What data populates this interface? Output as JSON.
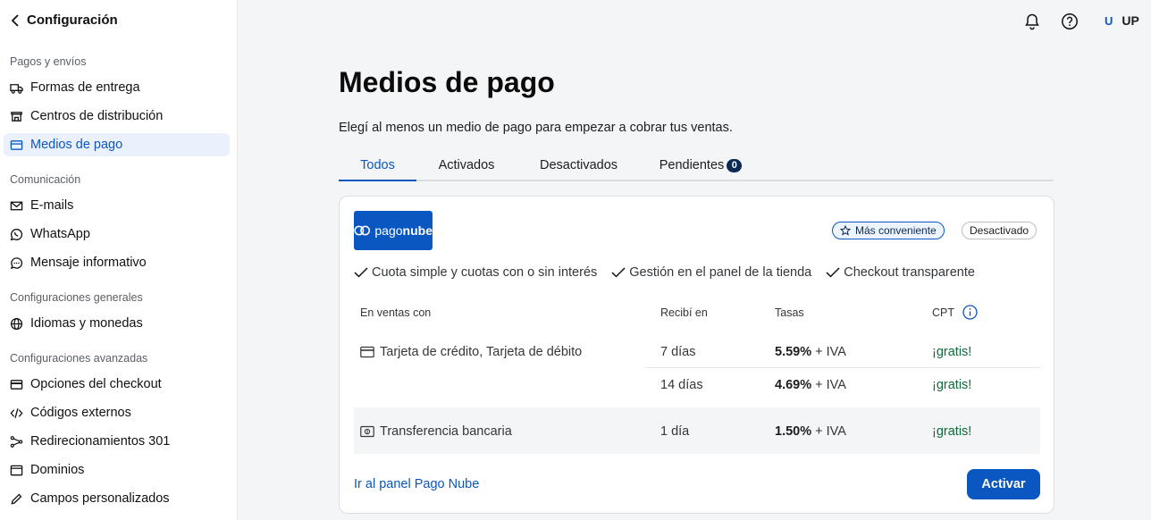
{
  "sidebar": {
    "back_label": "Configuración",
    "sections": [
      {
        "title": "Pagos y envíos"
      },
      {
        "title": "Comunicación"
      },
      {
        "title": "Configuraciones generales"
      },
      {
        "title": "Configuraciones avanzadas"
      }
    ],
    "items": [
      {
        "label": "Formas de entrega",
        "icon": "truck-icon"
      },
      {
        "label": "Centros de distribución",
        "icon": "store-icon"
      },
      {
        "label": "Medios de pago",
        "icon": "payment-icon",
        "active": true
      },
      {
        "label": "E-mails",
        "icon": "mail-icon"
      },
      {
        "label": "WhatsApp",
        "icon": "whatsapp-icon"
      },
      {
        "label": "Mensaje informativo",
        "icon": "chat-icon"
      },
      {
        "label": "Idiomas y monedas",
        "icon": "globe-icon"
      },
      {
        "label": "Opciones del checkout",
        "icon": "card-icon"
      },
      {
        "label": "Códigos externos",
        "icon": "code-icon"
      },
      {
        "label": "Redirecionamientos 301",
        "icon": "redirect-icon"
      },
      {
        "label": "Dominios",
        "icon": "browser-icon"
      },
      {
        "label": "Campos personalizados",
        "icon": "pencil-icon"
      }
    ]
  },
  "header": {
    "user_initial": "U",
    "user_label": "UP"
  },
  "main": {
    "title": "Medios de pago",
    "subtitle": "Elegí al menos un medio de pago para empezar a cobrar tus ventas.",
    "tabs": [
      {
        "label": "Todos",
        "active": true
      },
      {
        "label": "Activados"
      },
      {
        "label": "Desactivados"
      },
      {
        "label": "Pendientes",
        "count": "0"
      }
    ]
  },
  "card": {
    "logo_text_a": "pago",
    "logo_text_b": "nube",
    "chip_convenient": "Más conveniente",
    "chip_status": "Desactivado",
    "features": [
      "Cuota simple y cuotas con o sin interés",
      "Gestión en el panel de la tienda",
      "Checkout transparente"
    ],
    "table": {
      "headers": [
        "En ventas con",
        "Recibí en",
        "Tasas",
        "CPT"
      ],
      "rows": [
        {
          "method": "Tarjeta de crédito, Tarjeta de débito",
          "receive": "7 días",
          "rate": "5.59%",
          "tax": " + IVA",
          "cpt": "¡gratis!"
        },
        {
          "method": "",
          "receive": "14 días",
          "rate": "4.69%",
          "tax": " + IVA",
          "cpt": "¡gratis!"
        },
        {
          "method": "Transferencia bancaria",
          "receive": "1 día",
          "rate": "1.50%",
          "tax": " + IVA",
          "cpt": "¡gratis!"
        }
      ]
    },
    "link": "Ir al panel Pago Nube",
    "activate_button": "Activar"
  },
  "colors": {
    "accent": "#0a57c2",
    "active_bg": "#eaf1fd",
    "free_green": "#0c6b3a",
    "badge_bg": "#0b2a55"
  }
}
